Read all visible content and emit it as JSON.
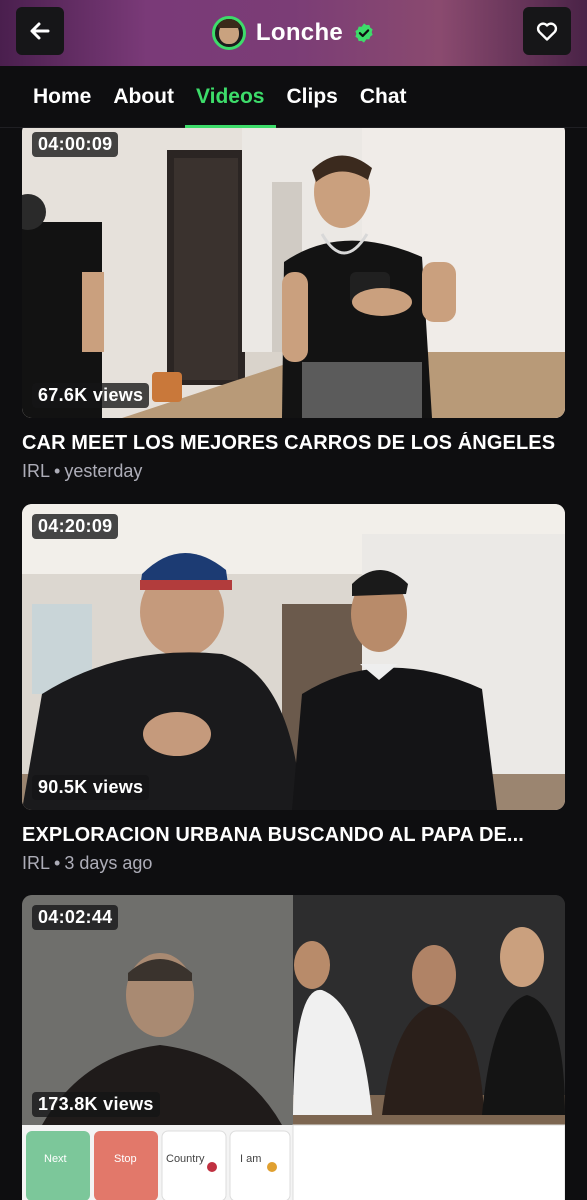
{
  "header": {
    "channel_name": "Lonche",
    "back_icon": "arrow-left-icon",
    "favorite_icon": "heart-outline-icon",
    "verified_icon": "verified-badge-icon",
    "accent": "#3ddc6a"
  },
  "tabs": [
    {
      "label": "Home"
    },
    {
      "label": "About"
    },
    {
      "label": "Videos",
      "active": true
    },
    {
      "label": "Clips"
    },
    {
      "label": "Chat"
    }
  ],
  "videos": [
    {
      "duration": "04:00:09",
      "views": "67.6K views",
      "title": "CAR MEET LOS MEJORES CARROS DE LOS ÁNGELES",
      "category": "IRL",
      "time": "yesterday"
    },
    {
      "duration": "04:20:09",
      "views": "90.5K views",
      "title": "EXPLORACION URBANA BUSCANDO AL PAPA DE...",
      "category": "IRL",
      "time": "3 days ago"
    },
    {
      "duration": "04:02:44",
      "views": "173.8K views",
      "overlay_buttons": [
        "Next",
        "Stop",
        "Country",
        "I am"
      ]
    }
  ]
}
